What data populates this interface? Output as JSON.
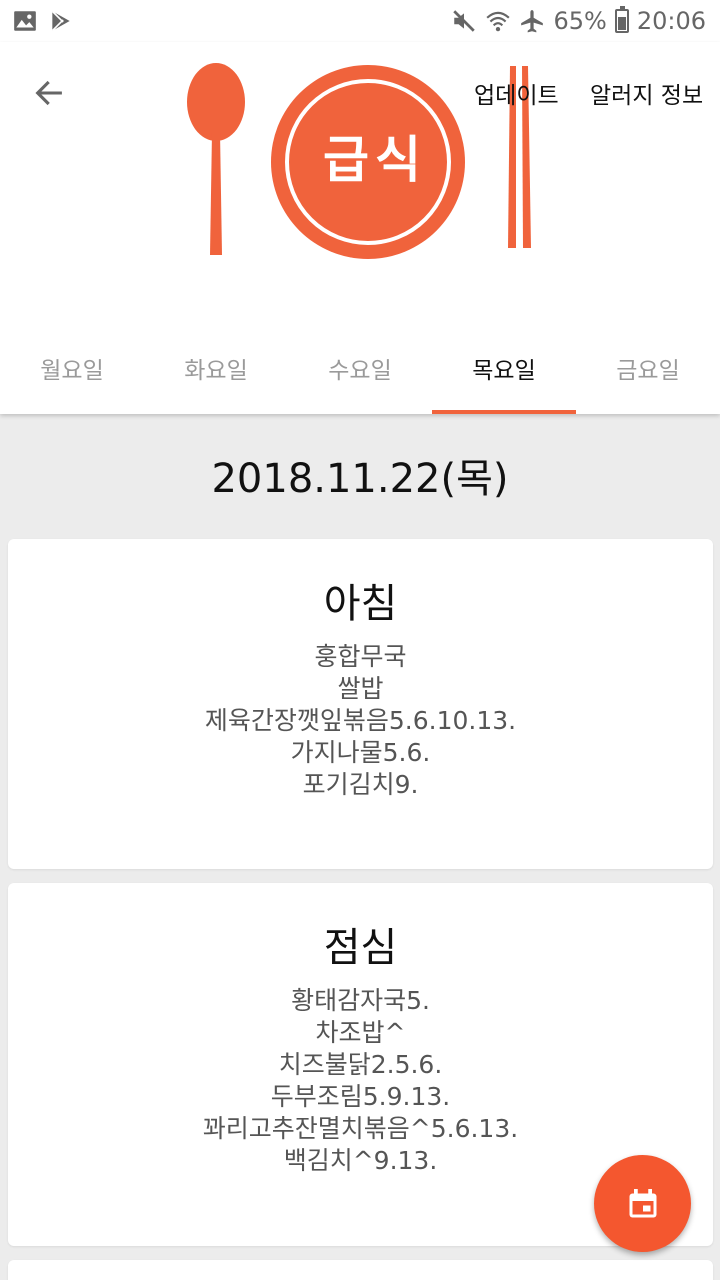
{
  "statusbar": {
    "battery_percent": "65%",
    "battery_level": 0.65,
    "time": "20:06",
    "icons": [
      "gallery-icon",
      "play-store-icon",
      "mute-icon",
      "wifi-icon",
      "airplane-icon",
      "battery-icon"
    ]
  },
  "header": {
    "logo_text": "급식",
    "update_label": "업데이트",
    "info_label": "알러지 정보",
    "accent_color": "#f0633c"
  },
  "tabs": [
    {
      "label": "월요일",
      "active": false
    },
    {
      "label": "화요일",
      "active": false
    },
    {
      "label": "수요일",
      "active": false
    },
    {
      "label": "목요일",
      "active": true
    },
    {
      "label": "금요일",
      "active": false
    }
  ],
  "date": "2018.11.22(목)",
  "meals": [
    {
      "title": "아침",
      "items": [
        "훙합무국",
        "쌀밥",
        "제육간장깻잎볶음5.6.10.13.",
        "가지나물5.6.",
        "포기김치9."
      ]
    },
    {
      "title": "점심",
      "items": [
        "황태감자국5.",
        "차조밥^",
        "치즈불닭2.5.6.",
        "두부조림5.9.13.",
        "꽈리고추잔멸치볶음^5.6.13.",
        "백김치^9.13."
      ]
    }
  ],
  "fab": {
    "icon": "calendar-icon",
    "color": "#f4572f"
  }
}
